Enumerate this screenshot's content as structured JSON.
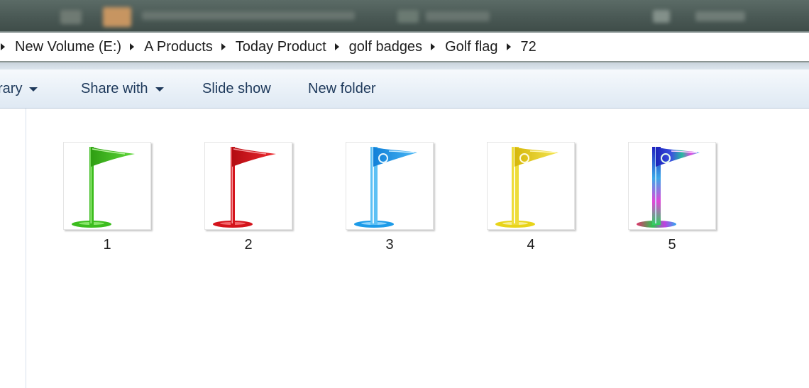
{
  "breadcrumb": {
    "items": [
      "New Volume (E:)",
      "A Products",
      "Today Product",
      "golf badges",
      "Golf flag",
      "72"
    ]
  },
  "toolbar": {
    "library_label": "rary",
    "share_with_label": "Share with",
    "slide_show_label": "Slide show",
    "new_folder_label": "New folder"
  },
  "files": [
    {
      "name": "1",
      "icon": "golf-flag-green-icon",
      "color": "#3cbd1e"
    },
    {
      "name": "2",
      "icon": "golf-flag-red-icon",
      "color": "#d4141c"
    },
    {
      "name": "3",
      "icon": "golf-flag-blue-icon",
      "color": "#1d9be8"
    },
    {
      "name": "4",
      "icon": "golf-flag-yellow-icon",
      "color": "#e8d41a"
    },
    {
      "name": "5",
      "icon": "golf-flag-multicolor-icon",
      "color": "#3040d0"
    }
  ]
}
